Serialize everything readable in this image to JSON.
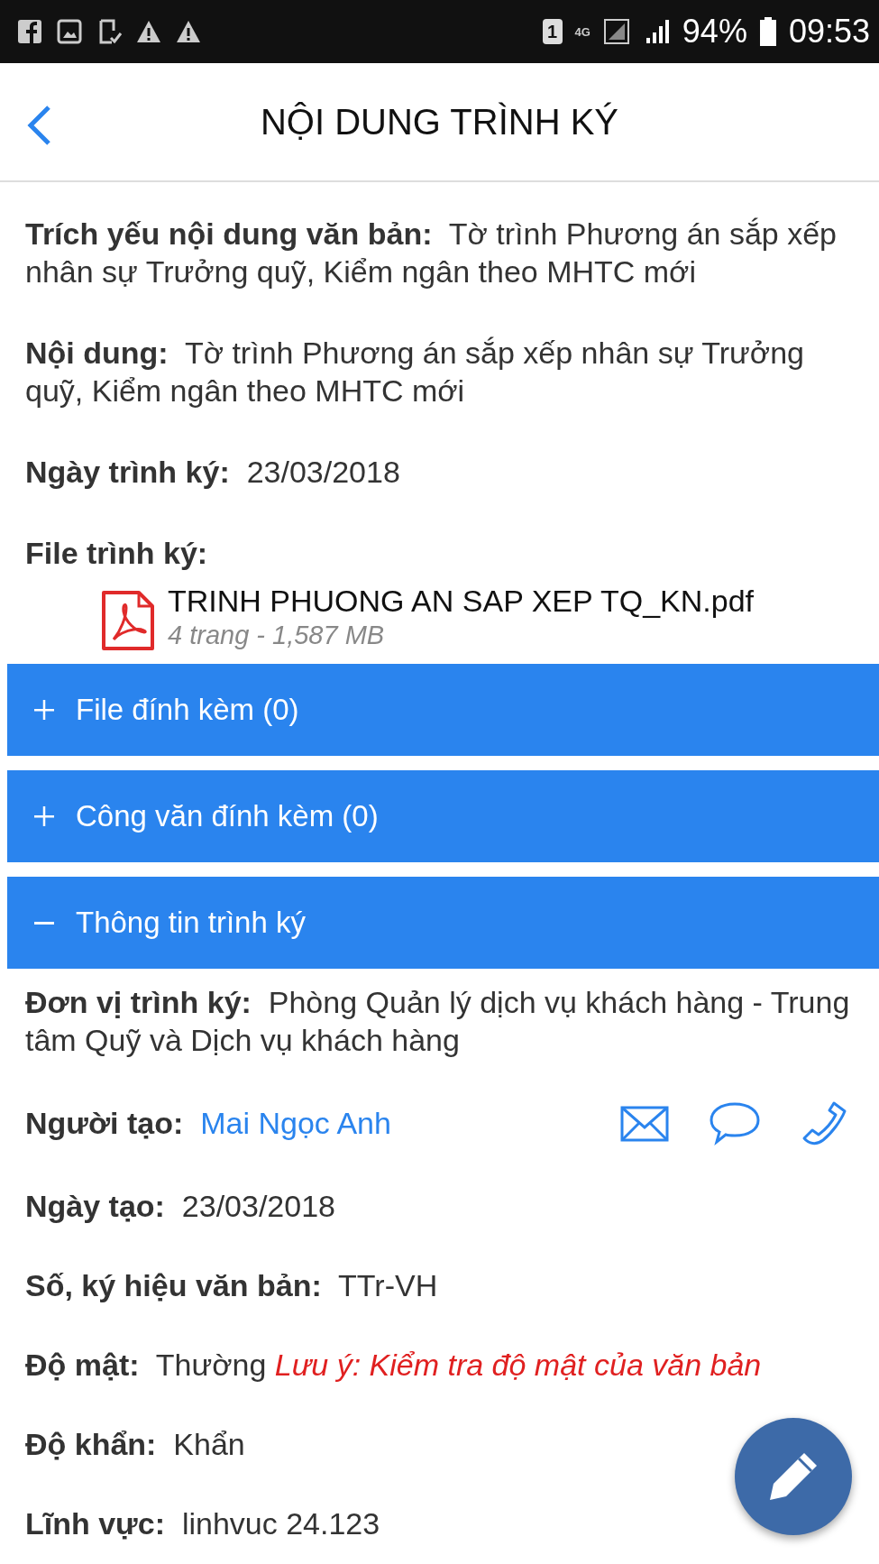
{
  "status_bar": {
    "sim_slot": "1",
    "network": "4G",
    "battery": "94%",
    "time": "09:53"
  },
  "header": {
    "title": "NỘI DUNG TRÌNH KÝ"
  },
  "fields": [
    {
      "kind": "text",
      "label": "Trích yếu nội dung văn bản:",
      "value": "Tờ trình Phương án sắp xếp nhân sự Trưởng quỹ, Kiểm ngân theo MHTC mới"
    },
    {
      "kind": "text",
      "label": "Nội dung:",
      "value": "Tờ trình Phương án sắp xếp nhân sự Trưởng quỹ, Kiểm ngân theo MHTC mới"
    },
    {
      "kind": "text",
      "label": "Ngày trình ký:",
      "value": "23/03/2018"
    },
    {
      "kind": "file",
      "label": "File trình ký:",
      "file_name": "TRINH PHUONG AN SAP XEP TQ_KN.pdf",
      "file_meta": "4 trang - 1,587 MB"
    }
  ],
  "sections": [
    {
      "title": "File đính kèm (0)",
      "expanded": false
    },
    {
      "title": "Công văn đính kèm (0)",
      "expanded": false
    },
    {
      "title": "Thông tin trình ký",
      "expanded": true
    }
  ],
  "details": [
    {
      "kind": "text",
      "label": "Đơn vị trình ký:",
      "value": "Phòng Quản lý dịch vụ khách hàng - Trung tâm Quỹ và Dịch vụ khách hàng"
    },
    {
      "kind": "contact",
      "label": "Người tạo:",
      "value": "Mai Ngọc Anh"
    },
    {
      "kind": "text",
      "label": "Ngày tạo:",
      "value": "23/03/2018"
    },
    {
      "kind": "text",
      "label": "Số, ký hiệu văn bản:",
      "value": "TTr-VH"
    },
    {
      "kind": "note",
      "label": "Độ mật:",
      "value": "Thường",
      "note": "Lưu ý: Kiểm tra độ mật của văn bản"
    },
    {
      "kind": "text",
      "label": "Độ khẩn:",
      "value": "Khẩn"
    },
    {
      "kind": "text",
      "label": "Lĩnh vực:",
      "value": "linhvuc 24.123"
    }
  ]
}
